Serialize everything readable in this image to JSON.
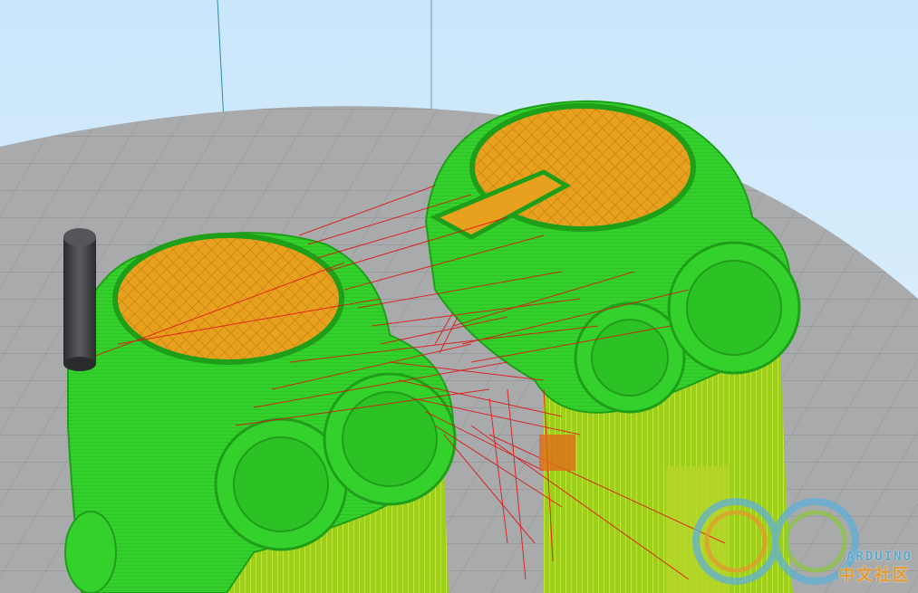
{
  "scene": {
    "view": "3d-layer-preview",
    "colors": {
      "sky_top": "#c9e6fb",
      "sky_bottom": "#e6f3fd",
      "bed": "#a9aaab",
      "bed_grid": "#8f9091",
      "shell": "#34d12c",
      "shell_dark": "#1f9e1a",
      "infill_top": "#e8a11e",
      "support": "#9ad21a",
      "travel": "#e01010",
      "nozzle_line": "#2e8aa0",
      "nozzle_rod": "#3c3d40"
    }
  },
  "watermark": {
    "text": "ARDUINO",
    "subtext": "中文社区",
    "ring_colors": [
      "#5fb0d6",
      "#e39b2f",
      "#8cc63f"
    ]
  }
}
